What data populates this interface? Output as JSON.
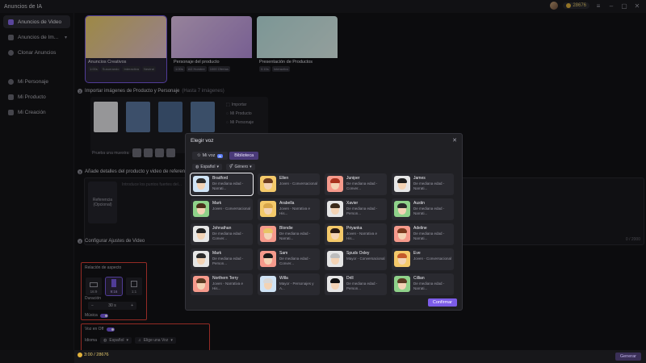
{
  "app": {
    "title": "Anuncios de IA",
    "credits": "28676"
  },
  "sidebar": {
    "items": [
      {
        "label": "Anuncios de Video",
        "icon": "video-icon",
        "active": true
      },
      {
        "label": "Anuncios de Im...",
        "icon": "image-icon",
        "active": false
      },
      {
        "label": "Clonar Anuncios",
        "icon": "clone-icon",
        "active": false
      },
      {
        "label": "Mi Personaje",
        "icon": "person-icon",
        "active": false
      },
      {
        "label": "Mi Producto",
        "icon": "product-icon",
        "active": false
      },
      {
        "label": "Mi Creación",
        "icon": "creation-icon",
        "active": false
      }
    ]
  },
  "templates": [
    {
      "title": "Anuncios Creativos",
      "tags": [
        "1:00s",
        "Susurrando",
        "Interactiva",
        "Neutral"
      ]
    },
    {
      "title": "Personaje del producto",
      "tags": [
        "1:00s",
        "AD Hombre",
        "1000 Ofertas"
      ]
    },
    {
      "title": "Presentación de Productos",
      "tags": [
        "0:15s",
        "Interactivo"
      ]
    }
  ],
  "section2": {
    "title": "Importar imágenes de Producto y Personaje",
    "hint": "(Hasta 7 imágenes)",
    "menu": [
      "Importar",
      "Mi Producto",
      "Mi Personaje"
    ],
    "try_label": "Prueba una muestra:"
  },
  "section3": {
    "title": "Añade detalles del producto y video de referencia",
    "ref_label": "Referencia",
    "ref_sub": "(Opcional)",
    "placeholder": "Introduce los puntos fuertes del...",
    "counter": "0 / 2000"
  },
  "section4": {
    "title": "Configurar Ajustes de Video",
    "ratio_label": "Relación de aspecto",
    "ratios": [
      "16:9",
      "9:16",
      "1:1"
    ],
    "duration_label": "Duración",
    "duration_value": "30 s",
    "music_label": "Música",
    "voice_off_label": "Voz en Off",
    "voice_row_label": "Idioma",
    "language": "Español",
    "choose_voice": "Elige una Voz"
  },
  "bottom": {
    "cost": "3:00 / 28676",
    "generate": "Generar"
  },
  "modal": {
    "title": "Elegir voz",
    "tabs": [
      "Mi voz",
      "Biblioteca"
    ],
    "ai_badge": "AI",
    "filters": [
      "Español",
      "Género"
    ],
    "voices": [
      {
        "name": "Bradford",
        "desc": "De mediana edad - Narrati...",
        "hair": "#2b2b2b",
        "bg": "#cfe3f5"
      },
      {
        "name": "Ellen",
        "desc": "Joven - Conversacional",
        "hair": "#6b3b20",
        "bg": "#f4c96a"
      },
      {
        "name": "Juniper",
        "desc": "De mediana edad - Conver...",
        "hair": "#a8321e",
        "bg": "#f59a8c"
      },
      {
        "name": "James",
        "desc": "De mediana edad - Narrati...",
        "hair": "#1e1e1e",
        "bg": "#e6e6e6"
      },
      {
        "name": "Mark",
        "desc": "Joven - Conversacional",
        "hair": "#4a2e1a",
        "bg": "#8fd28a"
      },
      {
        "name": "Arabella",
        "desc": "Joven - Narrativa e His...",
        "hair": "#d8a64a",
        "bg": "#f4c96a"
      },
      {
        "name": "Xavier",
        "desc": "De mediana edad - Person...",
        "hair": "#3a2a1a",
        "bg": "#e6e6e6"
      },
      {
        "name": "Austin",
        "desc": "De mediana edad - Narrati...",
        "hair": "#2a2a2a",
        "bg": "#8fd28a"
      },
      {
        "name": "Johnathan",
        "desc": "De mediana edad - Conver...",
        "hair": "#222",
        "bg": "#e6e6e6"
      },
      {
        "name": "Blondie",
        "desc": "De mediana edad - Narrati...",
        "hair": "#e9c465",
        "bg": "#f59a8c"
      },
      {
        "name": "Priyanka",
        "desc": "Joven - Narrativa e His...",
        "hair": "#2a1a12",
        "bg": "#f4c96a"
      },
      {
        "name": "Adeline",
        "desc": "De mediana edad - Narrati...",
        "hair": "#7a3a1e",
        "bg": "#f59a8c"
      },
      {
        "name": "Mark",
        "desc": "De mediana edad - Person...",
        "hair": "#2b2b2b",
        "bg": "#e6e6e6"
      },
      {
        "name": "Sam",
        "desc": "De mediana edad - Conver...",
        "hair": "#1a1a1a",
        "bg": "#f59a8c"
      },
      {
        "name": "Spuds Oxley",
        "desc": "Mayor - Conversacional",
        "hair": "#bdbdbd",
        "bg": "#e6e6e6"
      },
      {
        "name": "Eve",
        "desc": "Joven - Conversacional",
        "hair": "#c45a2a",
        "bg": "#f4c96a"
      },
      {
        "name": "Northern Terry",
        "desc": "Joven - Narrativa e His...",
        "hair": "#5a3a22",
        "bg": "#f59a8c"
      },
      {
        "name": "Willa",
        "desc": "Mayor - Personajes y A...",
        "hair": "#d8d8d8",
        "bg": "#cfe3f5"
      },
      {
        "name": "Drill",
        "desc": "De mediana edad - Person...",
        "hair": "#111",
        "bg": "#e6e6e6"
      },
      {
        "name": "Cillian",
        "desc": "De mediana edad - Narrati...",
        "hair": "#5a3a22",
        "bg": "#8fd28a"
      }
    ],
    "confirm": "Confirmar"
  }
}
